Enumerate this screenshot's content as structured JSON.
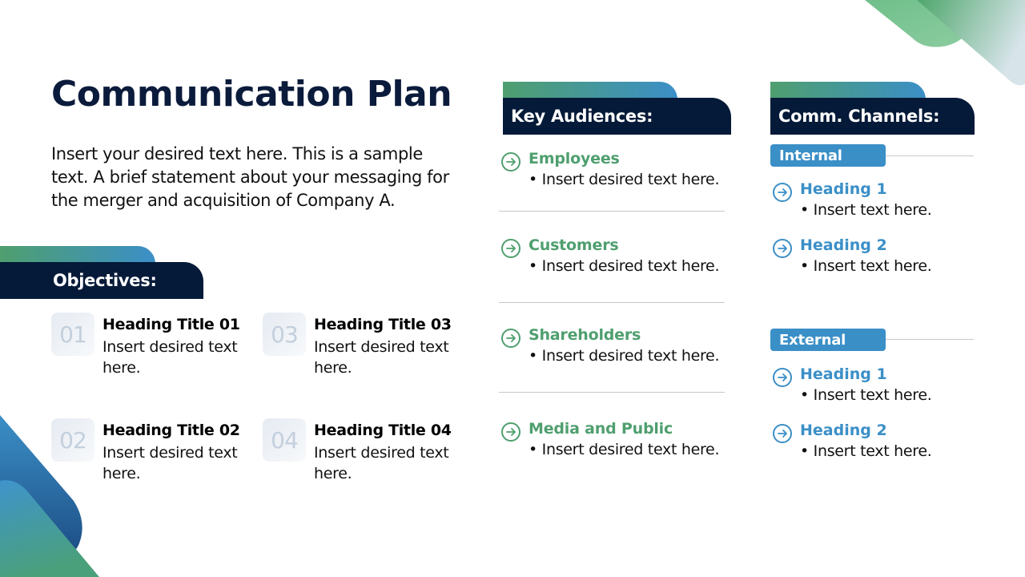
{
  "title": "Communication Plan",
  "intro": "Insert your desired text here. This is a sample text. A brief statement about your messaging for the merger and acquisition of Company A.",
  "colors": {
    "navy": "#041a38",
    "green": "#4f9f6f",
    "blue": "#3b8fc7",
    "number_gray": "#c3cfdd"
  },
  "objectives": {
    "header": "Objectives:",
    "items": [
      {
        "number": "01",
        "title": "Heading Title 01",
        "text": "Insert desired text here."
      },
      {
        "number": "02",
        "title": "Heading Title 02",
        "text": "Insert desired text here."
      },
      {
        "number": "03",
        "title": "Heading Title 03",
        "text": "Insert desired text here."
      },
      {
        "number": "04",
        "title": "Heading Title 04",
        "text": "Insert desired text here."
      }
    ]
  },
  "audiences": {
    "header": "Key Audiences:",
    "icon": "arrow-circle-right-icon",
    "items": [
      {
        "name": "Employees",
        "text": "• Insert desired text here."
      },
      {
        "name": "Customers",
        "text": "• Insert desired text here."
      },
      {
        "name": "Shareholders",
        "text": "• Insert desired text here."
      },
      {
        "name": "Media and Public",
        "text": "• Insert desired text here."
      }
    ]
  },
  "channels": {
    "header": "Comm. Channels:",
    "icon": "arrow-circle-right-icon",
    "groups": [
      {
        "label": "Internal",
        "items": [
          {
            "name": "Heading 1",
            "text": "• Insert text here."
          },
          {
            "name": "Heading 2",
            "text": "• Insert text here."
          }
        ]
      },
      {
        "label": "External",
        "items": [
          {
            "name": "Heading 1",
            "text": "• Insert text here."
          },
          {
            "name": "Heading 2",
            "text": "• Insert text here."
          }
        ]
      }
    ]
  }
}
